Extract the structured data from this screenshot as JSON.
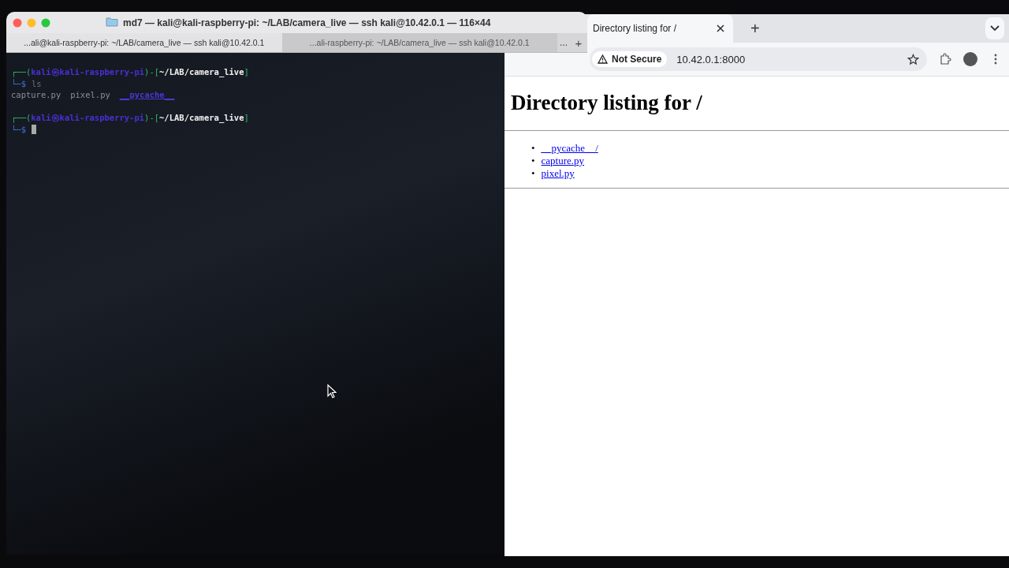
{
  "terminal": {
    "title": "md7 — kali@kali-raspberry-pi: ~/LAB/camera_live — ssh kali@10.42.0.1 — 116×44",
    "tabs": [
      {
        "label": "...ali@kali-raspberry-pi: ~/LAB/camera_live — ssh kali@10.42.0.1",
        "selected": true
      },
      {
        "label": "...ali-raspberry-pi: ~/LAB/camera_live — ssh kali@10.42.0.1",
        "selected": false
      }
    ],
    "tab_overflow": "...",
    "new_tab": "+",
    "lines": [
      {
        "kind": "header",
        "open": "┌──(",
        "user": "kali",
        "at": "㉿",
        "host": "kali-raspberry-pi",
        "mid": ")-[",
        "path": "~/LAB/camera_live",
        "close": "]"
      },
      {
        "kind": "command",
        "prompt": "└─$",
        "command": "ls",
        "cursor": false
      },
      {
        "kind": "listing",
        "files": [
          {
            "name": "capture.py",
            "kind": "file"
          },
          {
            "name": "pixel.py",
            "kind": "file"
          },
          {
            "name": "__pycache__",
            "kind": "dir"
          }
        ]
      },
      {
        "kind": "header",
        "open": "┌──(",
        "user": "kali",
        "at": "㉿",
        "host": "kali-raspberry-pi",
        "mid": ")-[",
        "path": "~/LAB/camera_live",
        "close": "]"
      },
      {
        "kind": "command",
        "prompt": "└─$",
        "cursor": true
      }
    ]
  },
  "browser": {
    "tabs": [
      {
        "label": "Directory listing for /",
        "selected": true
      }
    ],
    "new_tab": "+",
    "security": "Not Secure",
    "url": "10.42.0.1:8000",
    "page": {
      "heading": "Directory listing for /",
      "links": [
        {
          "bullet": "•",
          "label": "__pycache__/"
        },
        {
          "bullet": "•",
          "label": "capture.py"
        },
        {
          "bullet": "•",
          "label": "pixel.py"
        }
      ]
    }
  }
}
